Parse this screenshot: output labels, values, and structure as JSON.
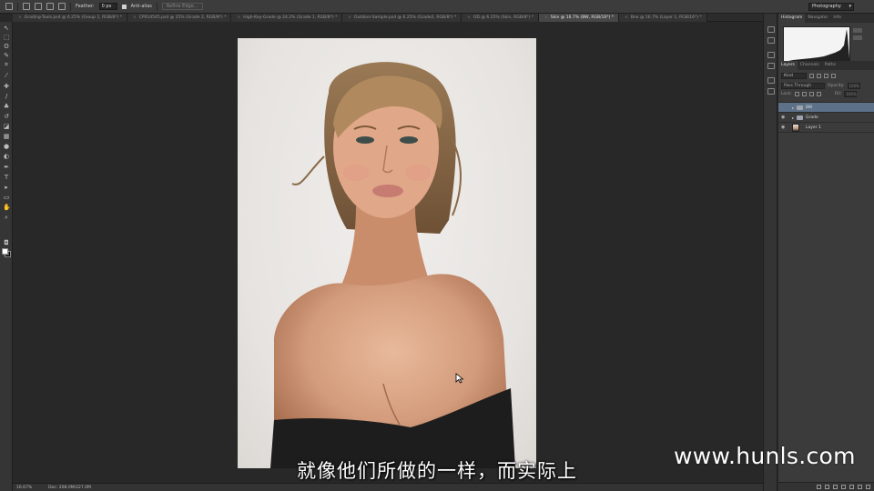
{
  "options_bar": {
    "feather_label": "Feather:",
    "feather_value": "0 px",
    "anti_alias_label": "Anti-alias",
    "refine_edge_label": "Refine Edge...",
    "workspace": "Photography"
  },
  "tabs": [
    {
      "label": "Grading-Tools.psd @ 6.25% (Group 1, RGB/8*) *"
    },
    {
      "label": "CP014545.psd @ 25% (Grade 2, RGB/8*) *"
    },
    {
      "label": "High-Key-Grade @ 24.2% (Grade 1, RGB/8*) *"
    },
    {
      "label": "Outdoor-Sample.psd @ 6.25% (Grade2, RGB/8*) *"
    },
    {
      "label": "OD @ 6.25% (Skin, RGB/8*) *"
    },
    {
      "label": "Skin @ 16.7% (BW, RGB/16*) *"
    },
    {
      "label": "Bne @ 16.7% (Layer 1, RGB/16*) *"
    }
  ],
  "right_panel": {
    "top_tabs": [
      "Histogram",
      "Navigator",
      "Info"
    ],
    "layers_tabs": [
      "Layers",
      "Channels",
      "Paths"
    ],
    "filter_kind": "Kind",
    "blend_mode": "Pass Through",
    "opacity_label": "Opacity:",
    "opacity_value": "100%",
    "lock_label": "Lock:",
    "fill_label": "Fill:",
    "fill_value": "100%",
    "layers": [
      {
        "name": "BW",
        "type": "group",
        "selected": true
      },
      {
        "name": "Grade",
        "type": "group",
        "selected": false
      },
      {
        "name": "Layer 1",
        "type": "pixel",
        "selected": false
      }
    ]
  },
  "status_bar": {
    "zoom": "16.67%",
    "doc_info": "Doc: 208.0M/227.0M"
  },
  "overlay": {
    "subtitle": "就像他们所做的一样，而实际上",
    "watermark": "www.hunls.com"
  }
}
